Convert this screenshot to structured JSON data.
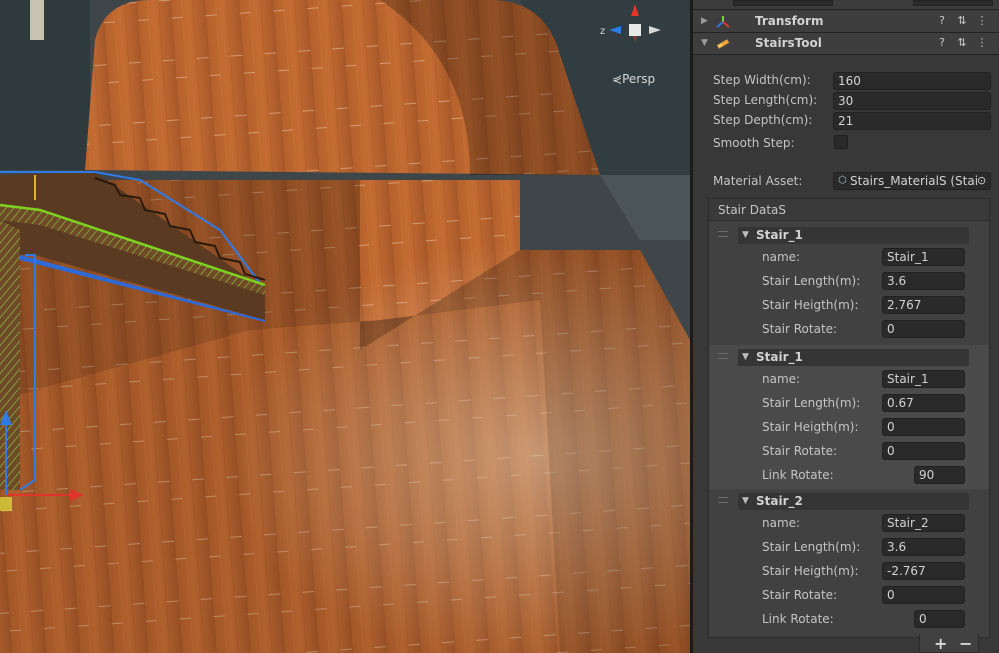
{
  "scene": {
    "view_mode": "Persp",
    "gizmo_axis_label": "z"
  },
  "inspector": {
    "components": [
      {
        "title": "Transform",
        "icon": "transform-icon"
      },
      {
        "title": "StairsTool",
        "icon": "script-icon"
      }
    ],
    "header_buttons": {
      "help": "?",
      "settings": "⇅",
      "menu": "⋮"
    },
    "fields": {
      "step_width": {
        "label": "Step Width(cm):",
        "value": "160"
      },
      "step_length": {
        "label": "Step Length(cm):",
        "value": "30"
      },
      "step_depth": {
        "label": "Step Depth(cm):",
        "value": "21"
      },
      "smooth_step": {
        "label": "Smooth Step:",
        "checked": false
      },
      "material_asset": {
        "label": "Material Asset:",
        "value": "Stairs_MaterialS (Stair"
      }
    },
    "stair_datas": {
      "title": "Stair DataS",
      "elements": [
        {
          "title": "Stair_1",
          "fields": [
            {
              "label": "name:",
              "value": "Stair_1"
            },
            {
              "label": "Stair Length(m):",
              "value": "3.6"
            },
            {
              "label": "Stair Heigth(m):",
              "value": "2.767"
            },
            {
              "label": "Stair Rotate:",
              "value": "0"
            }
          ]
        },
        {
          "title": "Stair_1",
          "fields": [
            {
              "label": "name:",
              "value": "Stair_1"
            },
            {
              "label": "Stair Length(m):",
              "value": "0.67"
            },
            {
              "label": "Stair Heigth(m):",
              "value": "0"
            },
            {
              "label": "Stair Rotate:",
              "value": "0"
            },
            {
              "label": "Link Rotate:",
              "value": "90"
            }
          ]
        },
        {
          "title": "Stair_2",
          "fields": [
            {
              "label": "name:",
              "value": "Stair_2"
            },
            {
              "label": "Stair Length(m):",
              "value": "3.6"
            },
            {
              "label": "Stair Heigth(m):",
              "value": "-2.767"
            },
            {
              "label": "Stair Rotate:",
              "value": "0"
            },
            {
              "label": "Link Rotate:",
              "value": "0"
            }
          ]
        }
      ],
      "add_label": "+",
      "remove_label": "−"
    }
  },
  "colors": {
    "inspector_bg": "#383838",
    "field_bg": "#2a2a2a",
    "wood": "#b5602b",
    "axis_x": "#e0352b",
    "axis_y": "#7ed321",
    "axis_z": "#2f7ae5"
  }
}
